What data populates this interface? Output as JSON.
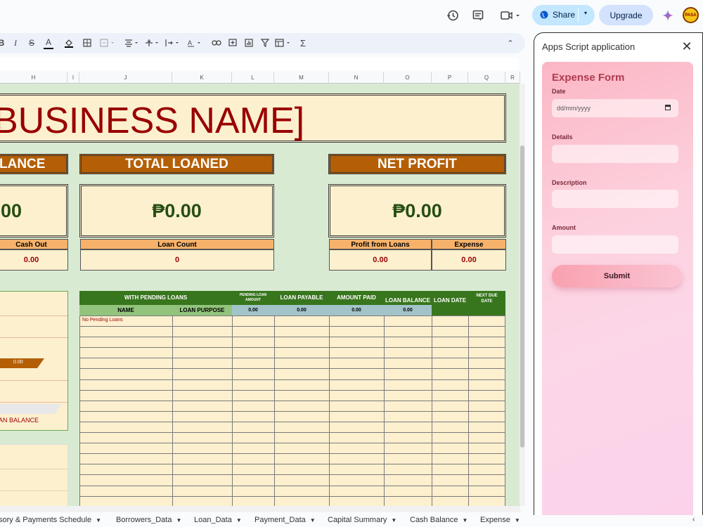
{
  "topbar": {
    "share_label": "Share",
    "upgrade_label": "Upgrade",
    "avatar_text": "PASA"
  },
  "columns": [
    "H",
    "I",
    "J",
    "K",
    "L",
    "M",
    "N",
    "O",
    "P",
    "Q",
    "R"
  ],
  "sheet": {
    "business_name": "BUSINESS NAME]",
    "balance_header": "LANCE",
    "total_loaned_header": "TOTAL LOANED",
    "net_profit_header": "NET PROFIT",
    "balance_value": "00",
    "total_loaned_value": "₱0.00",
    "net_profit_value": "₱0.00",
    "cash_out_label": "Cash Out",
    "cash_out_value": "0.00",
    "loan_count_label": "Loan Count",
    "loan_count_value": "0",
    "profit_from_loans_label": "Profit from Loans",
    "profit_from_loans_value": "0.00",
    "expense_label": "Expense",
    "expense_value": "0.00",
    "left_bar_value": "0.00",
    "left_panel_caption": "AN BALANCE"
  },
  "pending_table": {
    "title": "WITH PENDING LOANS",
    "pending_loan_amount": "PENDING LOAN AMOUNT",
    "loan_payable": "LOAN PAYABLE",
    "amount_paid": "AMOUNT PAID",
    "loan_balance": "LOAN BALANCE",
    "loan_date": "LOAN DATE",
    "next_due_date": "NEXT DUE DATE",
    "name_col": "NAME",
    "purpose_col": "LOAN PURPOSE",
    "totals": [
      "0.00",
      "0.00",
      "0.00",
      "0.00"
    ],
    "empty_text": "No Pending Loans"
  },
  "sidebar": {
    "title": "Apps Script application",
    "form_title": "Expense Form",
    "date_label": "Date",
    "date_placeholder": "dd/mm/yyyy",
    "details_label": "Details",
    "description_label": "Description",
    "amount_label": "Amount",
    "submit_label": "Submit"
  },
  "tabs": [
    "sory & Payments Schedule",
    "Borrowers_Data",
    "Loan_Data",
    "Payment_Data",
    "Capital Summary",
    "Cash Balance",
    "Expense"
  ]
}
